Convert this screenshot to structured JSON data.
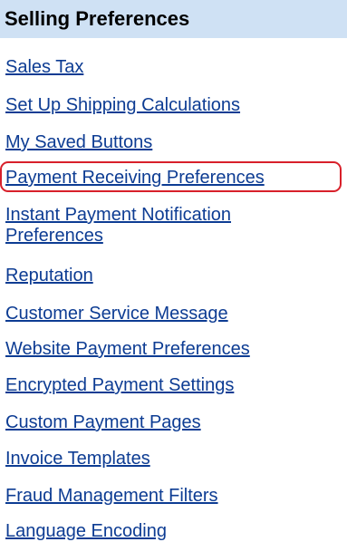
{
  "header": {
    "title": "Selling Preferences"
  },
  "links": [
    {
      "label": "Sales Tax"
    },
    {
      "label": "Set Up Shipping Calculations"
    },
    {
      "label": "My Saved Buttons"
    },
    {
      "label": "Payment Receiving Preferences",
      "highlighted": true
    },
    {
      "label": "Instant Payment Notification Preferences"
    },
    {
      "label": "Reputation"
    },
    {
      "label": "Customer Service Message"
    },
    {
      "label": "Website Payment Preferences"
    },
    {
      "label": "Encrypted Payment Settings"
    },
    {
      "label": "Custom Payment Pages"
    },
    {
      "label": "Invoice Templates"
    },
    {
      "label": "Fraud Management Filters"
    },
    {
      "label": "Language Encoding"
    }
  ],
  "colors": {
    "header_background": "#cfe1f4",
    "link_color": "#0d3c93",
    "highlight_border": "#d8202a"
  }
}
